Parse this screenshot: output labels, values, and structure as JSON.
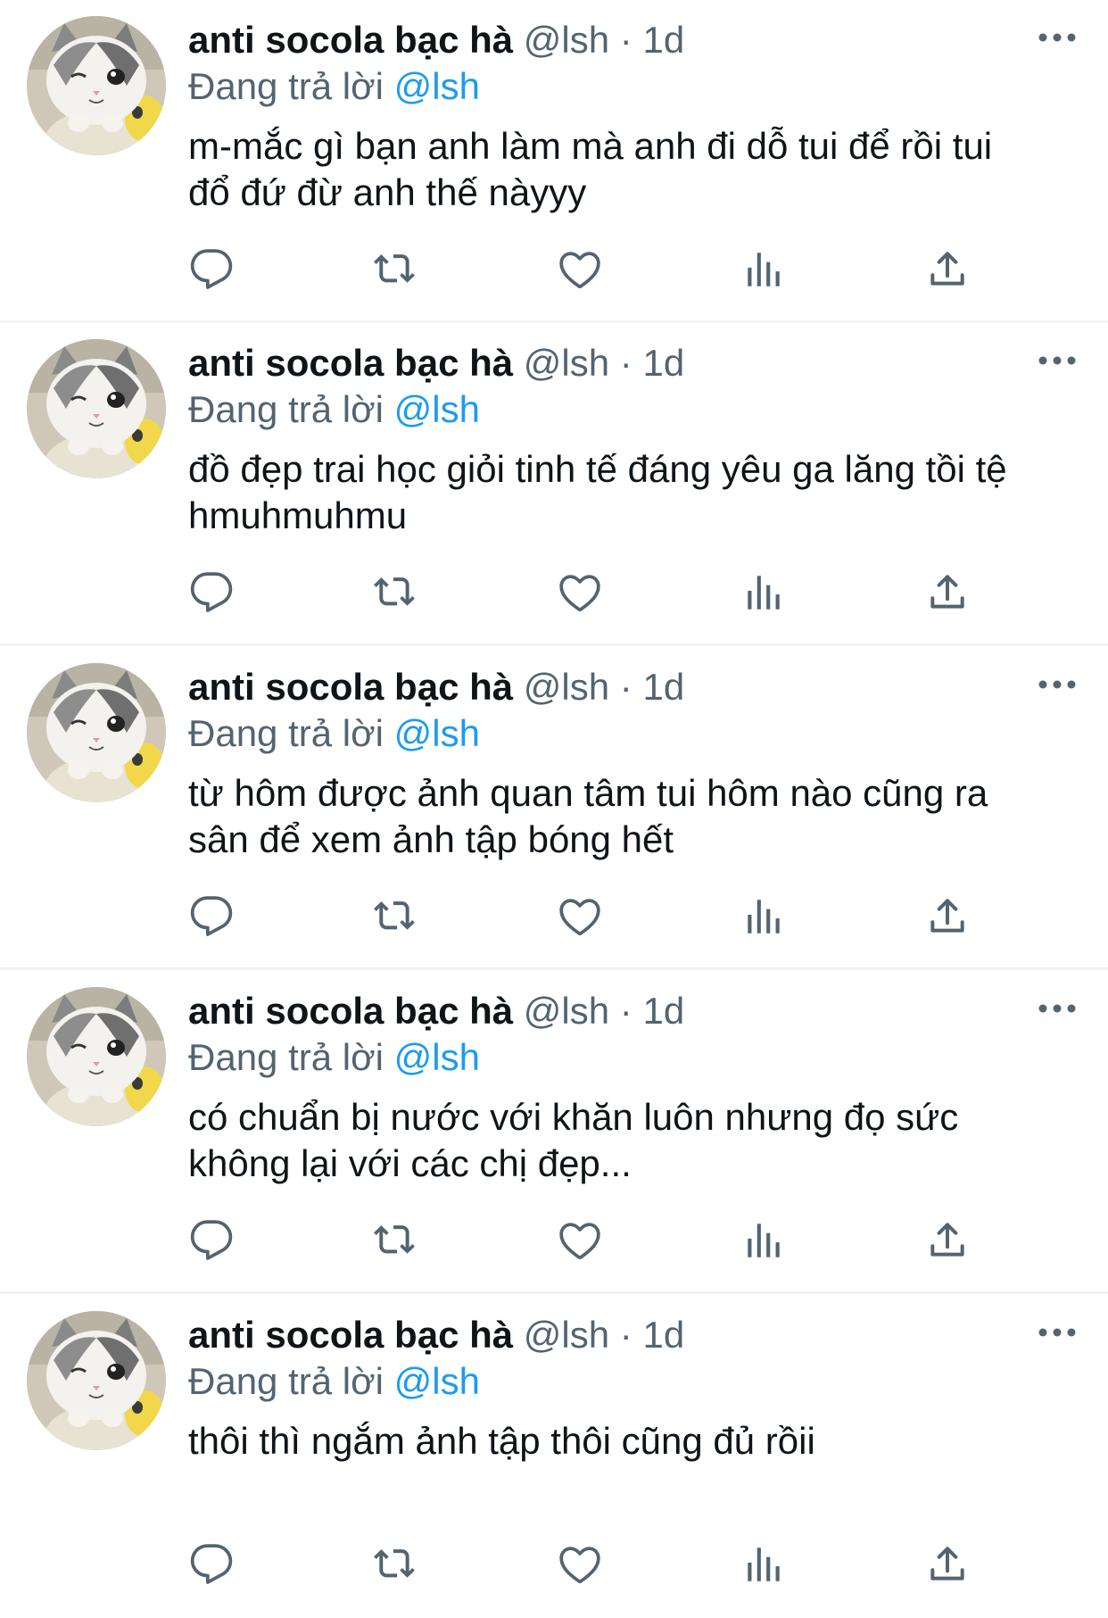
{
  "feed": {
    "tweets": [
      {
        "author": "anti socola bạc hà",
        "handle": "@lsh",
        "separator": "·",
        "time": "1d",
        "replying_label": "Đang trả lời",
        "replying_to": "@lsh",
        "text_lines": [
          "m-mắc gì bạn anh làm mà anh đi dỗ tui để rồi tui",
          "đổ đứ đừ anh thế nàyyy"
        ]
      },
      {
        "author": "anti socola bạc hà",
        "handle": "@lsh",
        "separator": "·",
        "time": "1d",
        "replying_label": "Đang trả lời",
        "replying_to": "@lsh",
        "text_lines": [
          "đồ đẹp trai học giỏi tinh tế đáng yêu ga lăng tồi tệ",
          "hmuhmuhmu"
        ]
      },
      {
        "author": "anti socola bạc hà",
        "handle": "@lsh",
        "separator": "·",
        "time": "1d",
        "replying_label": "Đang trả lời",
        "replying_to": "@lsh",
        "text_lines": [
          "từ hôm được ảnh quan tâm tui hôm nào cũng ra",
          "sân để xem ảnh tập bóng hết"
        ]
      },
      {
        "author": "anti socola bạc hà",
        "handle": "@lsh",
        "separator": "·",
        "time": "1d",
        "replying_label": "Đang trả lời",
        "replying_to": "@lsh",
        "text_lines": [
          "có chuẩn bị nước với khăn luôn nhưng đọ sức",
          "không lại với các chị đẹp..."
        ]
      },
      {
        "author": "anti socola bạc hà",
        "handle": "@lsh",
        "separator": "·",
        "time": "1d",
        "replying_label": "Đang trả lời",
        "replying_to": "@lsh",
        "text_lines": [
          "thôi thì ngắm ảnh tập thôi cũng đủ rồii"
        ]
      }
    ],
    "action_icons": [
      "reply-icon",
      "retweet-icon",
      "like-icon",
      "views-icon",
      "share-icon"
    ],
    "colors": {
      "text": "#0f1419",
      "secondary": "#536471",
      "link": "#1d9bf0",
      "divider": "#eff3f4"
    }
  }
}
